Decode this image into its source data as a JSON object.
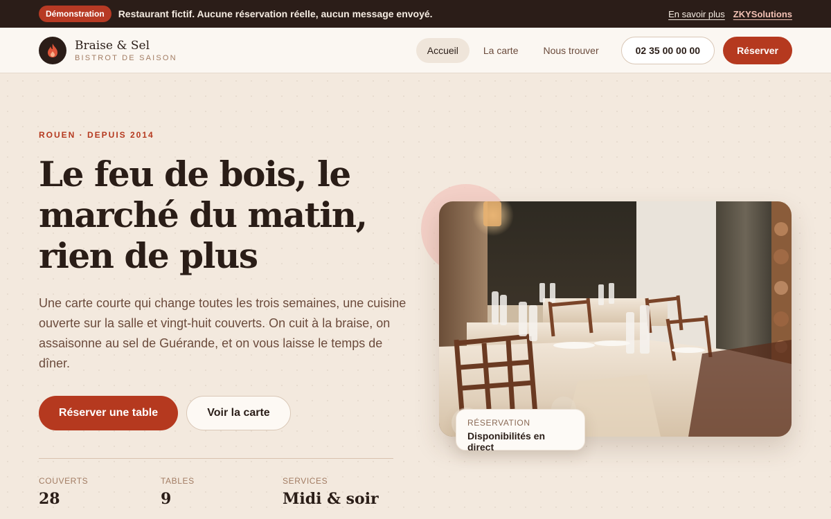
{
  "demo_bar": {
    "badge": "Démonstration",
    "notice": "Restaurant fictif. Aucune réservation réelle, aucun message envoyé.",
    "learn_more": "En savoir plus",
    "brand_link": "ZKYSolutions"
  },
  "header": {
    "name": "Braise & Sel",
    "tagline": "BISTROT DE SAISON",
    "logo_icon": "flame-icon",
    "nav": [
      {
        "label": "Accueil",
        "active": true
      },
      {
        "label": "La carte",
        "active": false
      },
      {
        "label": "Nous trouver",
        "active": false
      }
    ],
    "phone": "02 35 00 00 00",
    "reserve_label": "Réserver"
  },
  "hero": {
    "kicker": "ROUEN · DEPUIS 2014",
    "headline_lines": [
      "Le feu de bois, le",
      "marché du matin,",
      "rien de plus"
    ],
    "lede": "Une carte courte qui change toutes les trois semaines, une cuisine ouverte sur la salle et vingt-huit couverts. On cuit à la braise, on assaisonne au sel de Guérande, et on vous laisse le temps de dîner.",
    "cta_primary": "Réserver une table",
    "cta_secondary": "Voir la carte"
  },
  "stats": [
    {
      "label": "COUVERTS",
      "value": "28"
    },
    {
      "label": "TABLES",
      "value": "9"
    },
    {
      "label": "SERVICES",
      "value": "Midi & soir"
    }
  ],
  "photo_card": {
    "label": "RÉSERVATION",
    "value": "Disponibilités en direct"
  },
  "colors": {
    "accent": "#b5391f",
    "dark": "#2b1d18",
    "background": "#f3e9de"
  }
}
